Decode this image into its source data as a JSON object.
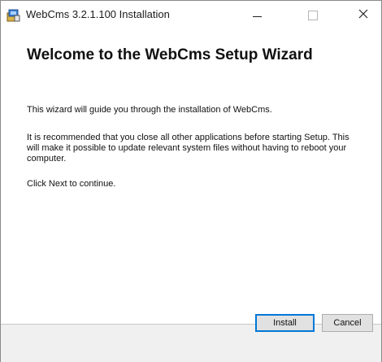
{
  "window": {
    "title": "WebCms 3.2.1.100 Installation",
    "icon": "installer-package-icon"
  },
  "titlebar_buttons": {
    "minimize": "minimize-icon",
    "maximize": "maximize-icon",
    "close": "close-icon"
  },
  "content": {
    "heading": "Welcome to the WebCms Setup Wizard",
    "paragraph1": "This wizard will guide you through the installation of WebCms.",
    "paragraph2": "It is recommended that you close all other applications before starting Setup. This will make it possible to update relevant system files without having to reboot your computer.",
    "paragraph3": "Click Next to continue."
  },
  "buttons": {
    "install": "Install",
    "cancel": "Cancel"
  }
}
